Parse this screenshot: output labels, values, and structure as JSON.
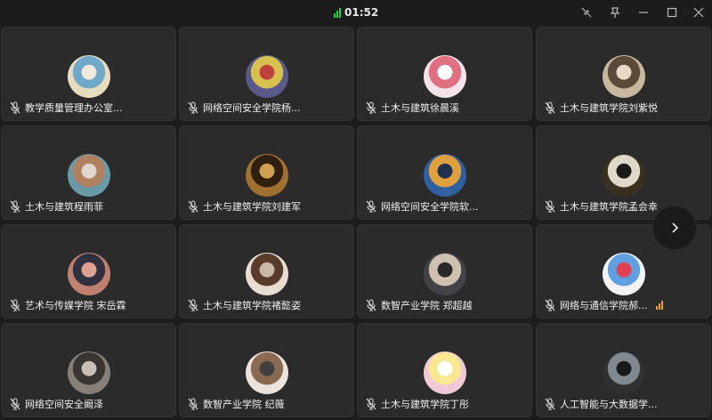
{
  "titlebar": {
    "timer": "01:52",
    "signal_color": "#2ecc40",
    "controls": [
      "minimize-to-float-icon",
      "pin-icon",
      "minimize-icon",
      "maximize-icon",
      "close-icon"
    ]
  },
  "participants": [
    {
      "name": "教学质量管理办公室...",
      "avatar_colors": [
        "#e8dcc0",
        "#6fa8c8",
        "#f0e8d8"
      ]
    },
    {
      "name": "网络空间安全学院杨...",
      "avatar_colors": [
        "#5a5a8a",
        "#d8c050",
        "#c04040"
      ]
    },
    {
      "name": "土木与建筑徐晨溪",
      "avatar_colors": [
        "#f4e4ea",
        "#e07080",
        "#ffffff"
      ]
    },
    {
      "name": "土木与建筑学院刘紫悦",
      "avatar_colors": [
        "#c8b8a0",
        "#5a4a3a",
        "#e8d8c8"
      ]
    },
    {
      "name": "土木与建筑程雨菲",
      "avatar_colors": [
        "#6a9aa8",
        "#b08060",
        "#e0d8d0"
      ]
    },
    {
      "name": "土木与建筑学院刘建军",
      "avatar_colors": [
        "#a07030",
        "#302010",
        "#d0a050"
      ]
    },
    {
      "name": "网络空间安全学院软...",
      "avatar_colors": [
        "#3060a0",
        "#e0a040",
        "#203050"
      ]
    },
    {
      "name": "土木与建筑学院孟会幸",
      "avatar_colors": [
        "#3a3020",
        "#e0d8c8",
        "#1a1a1a"
      ]
    },
    {
      "name": "艺术与传媒学院 宋岳霖",
      "avatar_colors": [
        "#c08070",
        "#303040",
        "#e0a090"
      ]
    },
    {
      "name": "土木与建筑学院褚懿姿",
      "avatar_colors": [
        "#e8ddd0",
        "#5a3a2a",
        "#c8b8a8"
      ]
    },
    {
      "name": "数智产业学院 郑超越",
      "avatar_colors": [
        "#404448",
        "#d0c0b0",
        "#2a2a2a"
      ]
    },
    {
      "name": "网络与通信学院郝...",
      "avatar_colors": [
        "#f4f4f8",
        "#60a0e0",
        "#e04050"
      ],
      "speaking": true
    },
    {
      "name": "网络空间安全阚泽",
      "avatar_colors": [
        "#888078",
        "#3a3530",
        "#c8c0b8"
      ]
    },
    {
      "name": "数智产业学院 纪薇",
      "avatar_colors": [
        "#ece4dc",
        "#8a6a50",
        "#404040"
      ]
    },
    {
      "name": "土木与建筑学院丁彤",
      "avatar_colors": [
        "#f0c8d8",
        "#f8e890",
        "#ffffff"
      ]
    },
    {
      "name": "人工智能与大数据学...",
      "avatar_colors": [
        "#303030",
        "#808890",
        "#1a1a1a"
      ]
    }
  ],
  "colors": {
    "background": "#1c1c1c",
    "tile": "#2b2b2b",
    "speaking_indicator": "#f0a020"
  },
  "next_page_icon": "chevron-right-icon"
}
